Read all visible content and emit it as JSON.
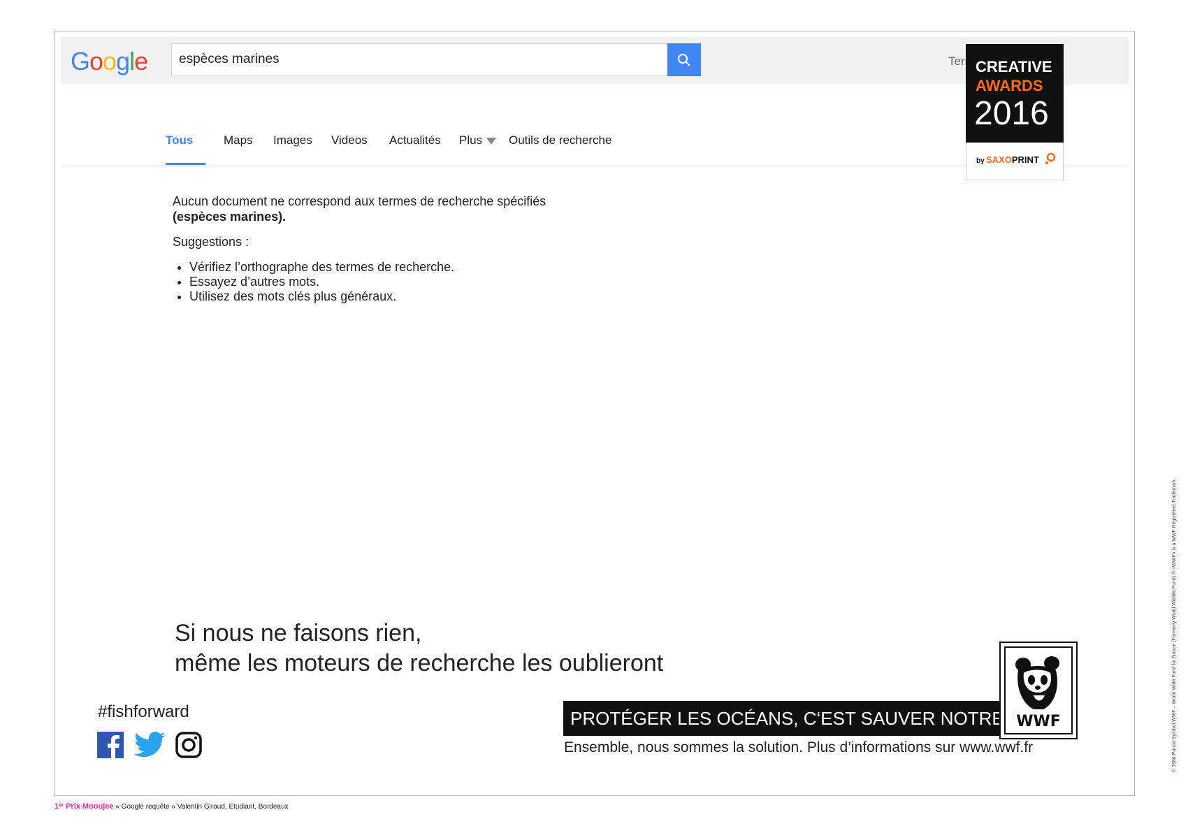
{
  "search": {
    "logo_letters": [
      "G",
      "o",
      "o",
      "g",
      "l",
      "e"
    ],
    "query": "espèces marines",
    "search_icon": "magnifier-icon",
    "region_link": "Terre",
    "apps_icon": "apps-grid-icon"
  },
  "tabs": [
    "Tous",
    "Maps",
    "Images",
    "Videos",
    "Actualités",
    "Plus",
    "Outils de recherche"
  ],
  "results": {
    "message_line1": "Aucun document ne correspond aux termes de recherche spécifiés",
    "message_line2": "(espèces marines).",
    "suggestions_heading": "Suggestions :",
    "suggestions": [
      "Vérifiez l’orthographe des termes de recherche.",
      "Essayez d’autres mots.",
      "Utilisez des mots clés plus généraux."
    ]
  },
  "campaign": {
    "headline_line1": "Si nous ne faisons rien,",
    "headline_line2": "même les moteurs de recherche les oublieront",
    "hashtag": "#fishforward",
    "social_icons": [
      "facebook-icon",
      "twitter-icon",
      "instagram-icon"
    ],
    "banner": "PROTÉGER LES OCÉANS, C‘EST SAUVER NOTRE PLANÈTE",
    "subline": "Ensemble, nous sommes la solution. Plus d’informations sur www.wwf.fr",
    "wwf_logo_text": "WWF",
    "legal_text": "© 1986 Panda Symbol WWF – World Wide Fund for Nature (Formerly World Wildlife Fund) ® «WWF» is a WWF Registered Trademark"
  },
  "award": {
    "line1": "CREATIVE",
    "line2": "AWARDS",
    "year": "2016",
    "by": "by",
    "brand_a": "SAXO",
    "brand_b": "PRINT",
    "accent_color": "#ff6a13"
  },
  "footer": {
    "prize": "1ᵉʳ Prix Mooujee",
    "credit": "« Google requête » Valentin Giraud, Etudiant, Bordeaux"
  }
}
